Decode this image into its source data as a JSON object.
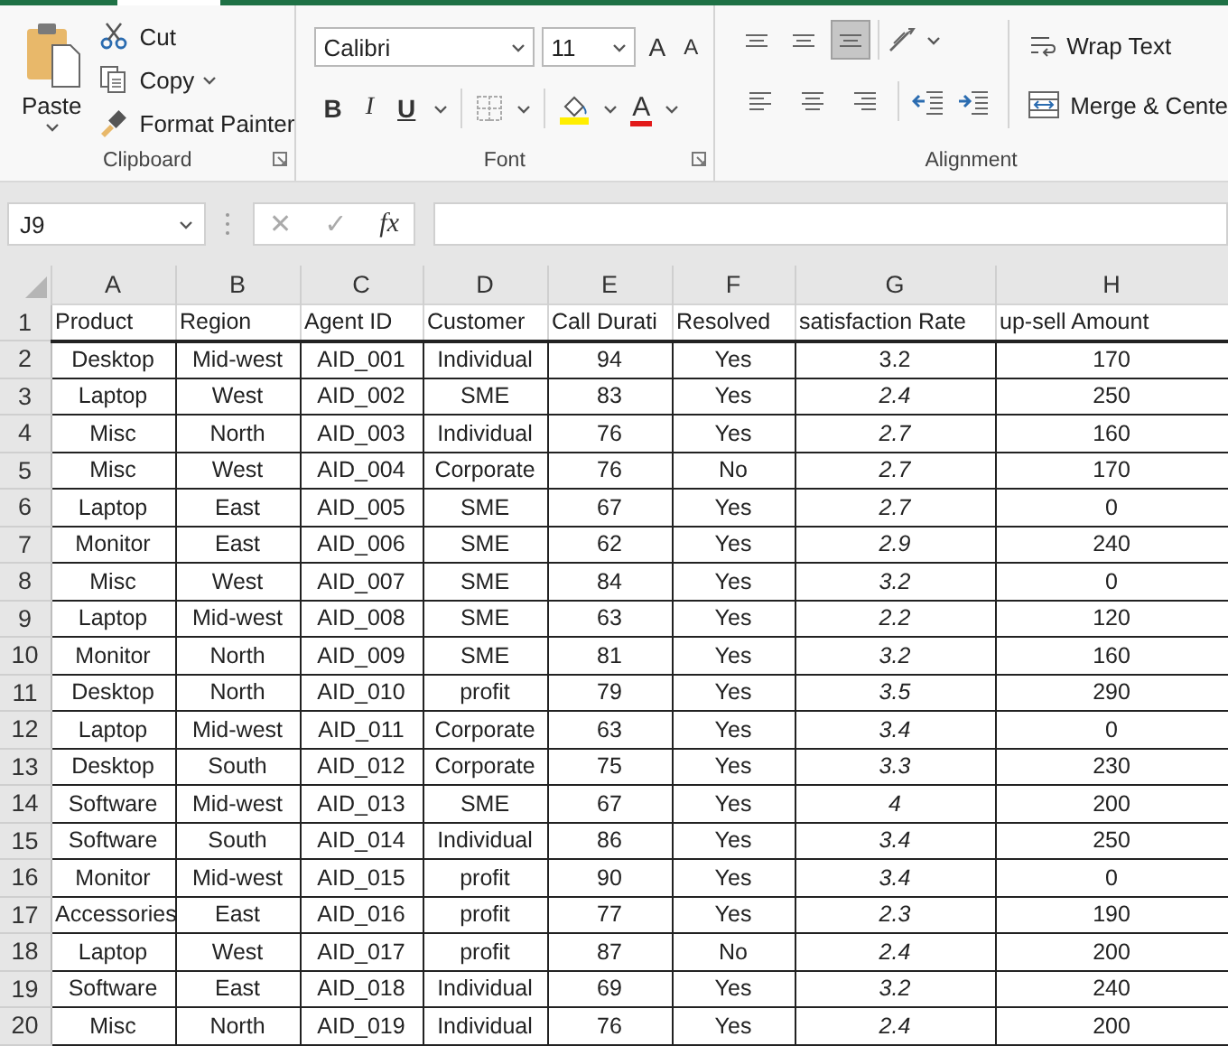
{
  "ribbon": {
    "clipboard": {
      "label": "Clipboard",
      "paste": "Paste",
      "cut": "Cut",
      "copy": "Copy",
      "format_painter": "Format Painter"
    },
    "font": {
      "label": "Font",
      "font_name": "Calibri",
      "font_size": "11",
      "grow": "A",
      "shrink": "A",
      "bold": "B",
      "italic": "I",
      "underline": "U",
      "font_color": "A"
    },
    "alignment": {
      "label": "Alignment",
      "wrap_text": "Wrap Text",
      "merge_center": "Merge & Cente",
      "buttons": [
        {
          "kind": "top",
          "selected": false
        },
        {
          "kind": "middle",
          "selected": false
        },
        {
          "kind": "bottom",
          "selected": true
        },
        {
          "kind": "left",
          "selected": false
        },
        {
          "kind": "center",
          "selected": false
        },
        {
          "kind": "right",
          "selected": false
        }
      ]
    }
  },
  "formula_bar": {
    "name_box": "J9",
    "cancel": "✕",
    "enter": "✓",
    "function": "fx"
  },
  "sheet": {
    "columns": [
      "A",
      "B",
      "C",
      "D",
      "E",
      "F",
      "G",
      "H"
    ],
    "rows": [
      {
        "number": "1",
        "header": true,
        "rating_italic": false,
        "cells": [
          "Product",
          "Region",
          "Agent ID",
          "Customer",
          "Call Durati",
          "Resolved",
          "satisfaction Rate",
          "up-sell Amount"
        ]
      },
      {
        "number": "2",
        "header": false,
        "rating_italic": false,
        "cells": [
          "Desktop",
          "Mid-west",
          "AID_001",
          "Individual",
          "94",
          "Yes",
          "3.2",
          "170"
        ]
      },
      {
        "number": "3",
        "header": false,
        "rating_italic": true,
        "cells": [
          "Laptop",
          "West",
          "AID_002",
          "SME",
          "83",
          "Yes",
          "2.4",
          "250"
        ]
      },
      {
        "number": "4",
        "header": false,
        "rating_italic": true,
        "cells": [
          "Misc",
          "North",
          "AID_003",
          "Individual",
          "76",
          "Yes",
          "2.7",
          "160"
        ]
      },
      {
        "number": "5",
        "header": false,
        "rating_italic": true,
        "cells": [
          "Misc",
          "West",
          "AID_004",
          "Corporate",
          "76",
          "No",
          "2.7",
          "170"
        ]
      },
      {
        "number": "6",
        "header": false,
        "rating_italic": true,
        "cells": [
          "Laptop",
          "East",
          "AID_005",
          "SME",
          "67",
          "Yes",
          "2.7",
          "0"
        ]
      },
      {
        "number": "7",
        "header": false,
        "rating_italic": true,
        "cells": [
          "Monitor",
          "East",
          "AID_006",
          "SME",
          "62",
          "Yes",
          "2.9",
          "240"
        ]
      },
      {
        "number": "8",
        "header": false,
        "rating_italic": true,
        "cells": [
          "Misc",
          "West",
          "AID_007",
          "SME",
          "84",
          "Yes",
          "3.2",
          "0"
        ]
      },
      {
        "number": "9",
        "header": false,
        "rating_italic": true,
        "cells": [
          "Laptop",
          "Mid-west",
          "AID_008",
          "SME",
          "63",
          "Yes",
          "2.2",
          "120"
        ]
      },
      {
        "number": "10",
        "header": false,
        "rating_italic": true,
        "cells": [
          "Monitor",
          "North",
          "AID_009",
          "SME",
          "81",
          "Yes",
          "3.2",
          "160"
        ]
      },
      {
        "number": "11",
        "header": false,
        "rating_italic": true,
        "cells": [
          "Desktop",
          "North",
          "AID_010",
          "profit",
          "79",
          "Yes",
          "3.5",
          "290"
        ]
      },
      {
        "number": "12",
        "header": false,
        "rating_italic": true,
        "cells": [
          "Laptop",
          "Mid-west",
          "AID_011",
          "Corporate",
          "63",
          "Yes",
          "3.4",
          "0"
        ]
      },
      {
        "number": "13",
        "header": false,
        "rating_italic": true,
        "cells": [
          "Desktop",
          "South",
          "AID_012",
          "Corporate",
          "75",
          "Yes",
          "3.3",
          "230"
        ]
      },
      {
        "number": "14",
        "header": false,
        "rating_italic": true,
        "cells": [
          "Software",
          "Mid-west",
          "AID_013",
          "SME",
          "67",
          "Yes",
          "4",
          "200"
        ]
      },
      {
        "number": "15",
        "header": false,
        "rating_italic": true,
        "cells": [
          "Software",
          "South",
          "AID_014",
          "Individual",
          "86",
          "Yes",
          "3.4",
          "250"
        ]
      },
      {
        "number": "16",
        "header": false,
        "rating_italic": true,
        "cells": [
          "Monitor",
          "Mid-west",
          "AID_015",
          "profit",
          "90",
          "Yes",
          "3.4",
          "0"
        ]
      },
      {
        "number": "17",
        "header": false,
        "rating_italic": true,
        "cells": [
          "Accessories",
          "East",
          "AID_016",
          "profit",
          "77",
          "Yes",
          "2.3",
          "190"
        ]
      },
      {
        "number": "18",
        "header": false,
        "rating_italic": true,
        "cells": [
          "Laptop",
          "West",
          "AID_017",
          "profit",
          "87",
          "No",
          "2.4",
          "200"
        ]
      },
      {
        "number": "19",
        "header": false,
        "rating_italic": true,
        "cells": [
          "Software",
          "East",
          "AID_018",
          "Individual",
          "69",
          "Yes",
          "3.2",
          "240"
        ]
      },
      {
        "number": "20",
        "header": false,
        "rating_italic": true,
        "cells": [
          "Misc",
          "North",
          "AID_019",
          "Individual",
          "76",
          "Yes",
          "2.4",
          "200"
        ]
      }
    ]
  }
}
